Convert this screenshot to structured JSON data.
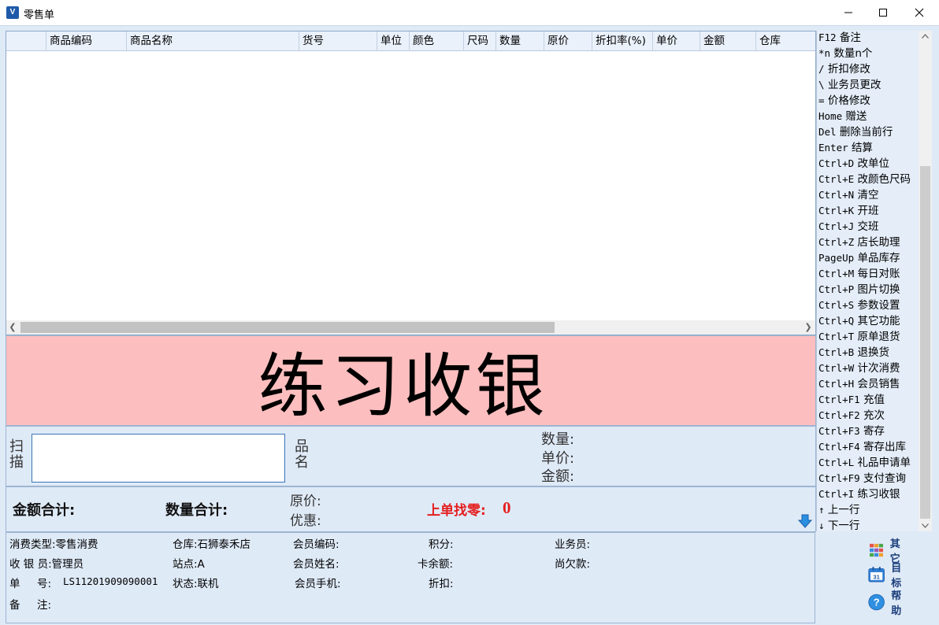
{
  "window": {
    "title": "零售单"
  },
  "grid": {
    "columns": [
      "商品编码",
      "商品名称",
      "货号",
      "单位",
      "颜色",
      "尺码",
      "数量",
      "原价",
      "折扣率(%)",
      "单价",
      "金额",
      "仓库"
    ]
  },
  "banner": {
    "text": "练习收银"
  },
  "scan": {
    "label": "扫描",
    "product_name_label": "品名",
    "quantity_label": "数量:",
    "unit_price_label": "单价:",
    "amount_label": "金额:"
  },
  "totals": {
    "amount_total_label": "金额合计:",
    "quantity_total_label": "数量合计:",
    "original_price_label": "原价:",
    "discount_label": "优惠:",
    "change_label": "上单找零:",
    "change_value": "0"
  },
  "info": {
    "consume_type": "消费类型:零售消费",
    "warehouse": "仓库:石狮泰禾店",
    "member_code": "会员编码:",
    "points": "积分:",
    "salesperson": "业务员:",
    "cashier": "收 银 员:管理员",
    "station": "站点:A",
    "member_name": "会员姓名:",
    "card_balance": "卡余额:",
    "owed": "尚欠款:",
    "order_no_label": "单     号:",
    "order_no_value": "LS11201909090001",
    "status": "状态:联机",
    "member_phone": "会员手机:",
    "discount": "折扣:",
    "remark": "备     注:"
  },
  "side_actions": {
    "other": "其它",
    "target": "目标",
    "help": "帮助",
    "calendar_day": "31"
  },
  "shortcuts": [
    {
      "key": "F12",
      "desc": "备注"
    },
    {
      "key": "*n",
      "desc": " 数量n个"
    },
    {
      "key": "/",
      "desc": "折扣修改"
    },
    {
      "key": "\\",
      "desc": "业务员更改"
    },
    {
      "key": "=",
      "desc": "价格修改"
    },
    {
      "key": "Home",
      "desc": "赠送"
    },
    {
      "key": "Del",
      "desc": "删除当前行"
    },
    {
      "key": "Enter",
      "desc": "结算"
    },
    {
      "key": "Ctrl+D",
      "desc": "改单位"
    },
    {
      "key": "Ctrl+E",
      "desc": "改颜色尺码"
    },
    {
      "key": "Ctrl+N",
      "desc": "清空"
    },
    {
      "key": "Ctrl+K",
      "desc": "开班"
    },
    {
      "key": "Ctrl+J",
      "desc": "交班"
    },
    {
      "key": "Ctrl+Z",
      "desc": "店长助理"
    },
    {
      "key": "PageUp",
      "desc": "单品库存"
    },
    {
      "key": "Ctrl+M",
      "desc": "每日对账"
    },
    {
      "key": "Ctrl+P",
      "desc": "图片切换"
    },
    {
      "key": "Ctrl+S",
      "desc": "参数设置"
    },
    {
      "key": "Ctrl+Q",
      "desc": "其它功能"
    },
    {
      "key": "Ctrl+T",
      "desc": "原单退货"
    },
    {
      "key": "Ctrl+B",
      "desc": "退换货"
    },
    {
      "key": "Ctrl+W",
      "desc": "计次消费"
    },
    {
      "key": "Ctrl+H",
      "desc": "会员销售"
    },
    {
      "key": "Ctrl+F1",
      "desc": "充值"
    },
    {
      "key": "Ctrl+F2",
      "desc": "充次"
    },
    {
      "key": "Ctrl+F3",
      "desc": "寄存"
    },
    {
      "key": "Ctrl+F4",
      "desc": "寄存出库"
    },
    {
      "key": "Ctrl+L",
      "desc": "礼品申请单"
    },
    {
      "key": "Ctrl+F9",
      "desc": "支付查询"
    },
    {
      "key": "Ctrl+I",
      "desc": "练习收银"
    },
    {
      "key": "↑",
      "desc": " 上一行"
    },
    {
      "key": "↓",
      "desc": " 下一行"
    }
  ],
  "colors": {
    "banner_bg": "#fcbebe",
    "panel_bg": "#dfeaf7",
    "change_text": "#e41e1e",
    "accent": "#1e5aa8"
  }
}
